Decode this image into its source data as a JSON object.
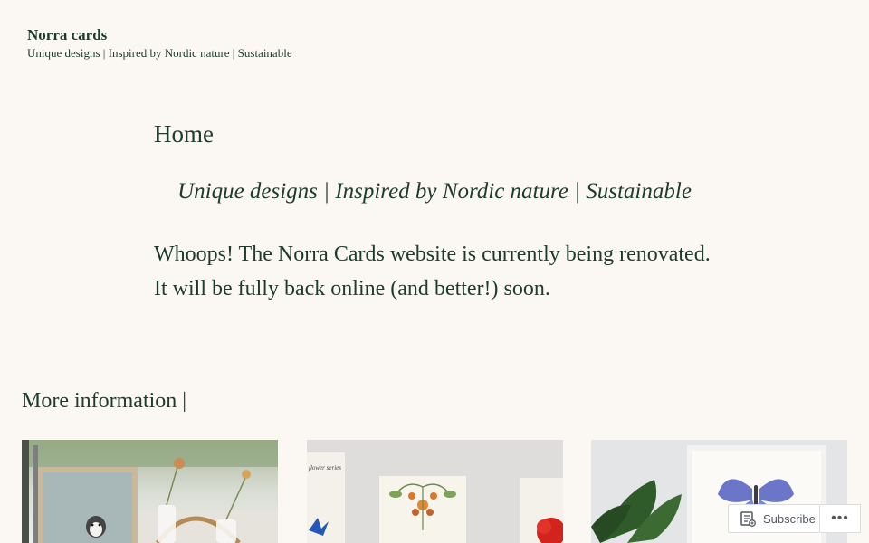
{
  "header": {
    "site_title": "Norra cards",
    "site_tagline": "Unique designs | Inspired by Nordic nature | Sustainable"
  },
  "main": {
    "page_title": "Home",
    "tagline": "Unique designs | Inspired by Nordic nature | Sustainable",
    "notice": "Whoops! The Norra Cards website is currently being renovated. It will be fully back online (and better!) soon.",
    "more_info_heading": "More information |"
  },
  "gallery": {
    "items": [
      {
        "subject": "penguin print in frame on table"
      },
      {
        "subject": "flower series cards"
      },
      {
        "subject": "butterfly print with monstera leaf"
      }
    ],
    "card_series_caption": "flower series"
  },
  "actionbar": {
    "subscribe_label": "Subscribe",
    "more_label": "•••"
  },
  "colors": {
    "background": "#fbf8f3",
    "text": "#1e3b30"
  }
}
